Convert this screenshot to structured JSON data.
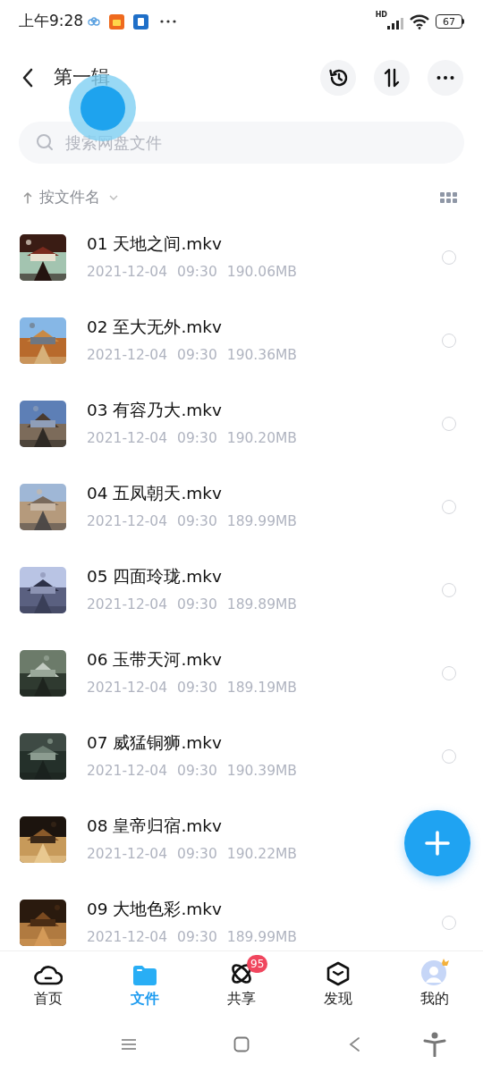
{
  "status_bar": {
    "time": "上午9:28",
    "network": "HD",
    "battery": "67"
  },
  "header": {
    "title": "第一辑"
  },
  "search": {
    "placeholder": "搜索网盘文件"
  },
  "sort": {
    "label": "按文件名"
  },
  "files": [
    {
      "name": "01 天地之间.mkv",
      "date": "2021-12-04",
      "time": "09:30",
      "size": "190.06MB",
      "checked": false
    },
    {
      "name": "02 至大无外.mkv",
      "date": "2021-12-04",
      "time": "09:30",
      "size": "190.36MB",
      "checked": false
    },
    {
      "name": "03 有容乃大.mkv",
      "date": "2021-12-04",
      "time": "09:30",
      "size": "190.20MB",
      "checked": false
    },
    {
      "name": "04 五凤朝天.mkv",
      "date": "2021-12-04",
      "time": "09:30",
      "size": "189.99MB",
      "checked": false
    },
    {
      "name": "05 四面玲珑.mkv",
      "date": "2021-12-04",
      "time": "09:30",
      "size": "189.89MB",
      "checked": false
    },
    {
      "name": "06 玉带天河.mkv",
      "date": "2021-12-04",
      "time": "09:30",
      "size": "189.19MB",
      "checked": false
    },
    {
      "name": "07 威猛铜狮.mkv",
      "date": "2021-12-04",
      "time": "09:30",
      "size": "190.39MB",
      "checked": false
    },
    {
      "name": "08 皇帝归宿.mkv",
      "date": "2021-12-04",
      "time": "09:30",
      "size": "190.22MB"
    },
    {
      "name": "09 大地色彩.mkv",
      "date": "2021-12-04",
      "time": "09:30",
      "size": "189.99MB",
      "checked": false
    }
  ],
  "tab_bar": [
    {
      "kind": "home",
      "label": "首页",
      "selected": false
    },
    {
      "kind": "files",
      "label": "文件",
      "selected": true
    },
    {
      "kind": "share",
      "label": "共享",
      "selected": false,
      "badge": "95"
    },
    {
      "kind": "discover",
      "label": "发现",
      "selected": false
    },
    {
      "kind": "me",
      "label": "我的",
      "selected": false
    }
  ]
}
